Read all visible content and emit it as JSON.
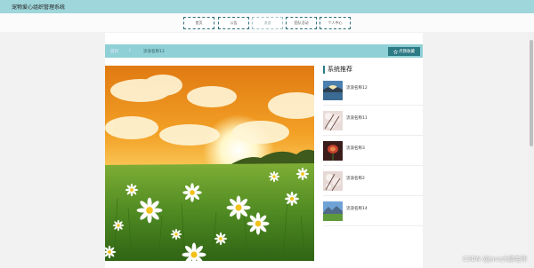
{
  "app": {
    "title": "宠物爱心组织管理系统"
  },
  "nav": {
    "items": [
      {
        "label": "首页",
        "active": false
      },
      {
        "label": "公告",
        "active": false
      },
      {
        "label": "流浪",
        "active": true
      },
      {
        "label": "团队活动",
        "active": false
      },
      {
        "label": "个人中心",
        "active": false
      }
    ]
  },
  "breadcrumb": {
    "home": "首页",
    "separator": "/",
    "current": "流浪名称13"
  },
  "favorite": {
    "icon": "star-icon",
    "label": "点我收藏"
  },
  "recommend": {
    "title": "系统推荐",
    "items": [
      {
        "name": "流浪名称12",
        "icon": "lake-thumb"
      },
      {
        "name": "流浪名称11",
        "icon": "blossom-thumb"
      },
      {
        "name": "流浪名称3",
        "icon": "flower-thumb"
      },
      {
        "name": "流浪名称2",
        "icon": "blossom-thumb"
      },
      {
        "name": "流浪名称14",
        "icon": "mountain-thumb"
      }
    ]
  },
  "watermark": "CSDN @Java大鹏老师",
  "colors": {
    "accent": "#2c7a84",
    "topbar": "#9fd6db",
    "breadcrumb_bar": "#8fd0d6"
  }
}
